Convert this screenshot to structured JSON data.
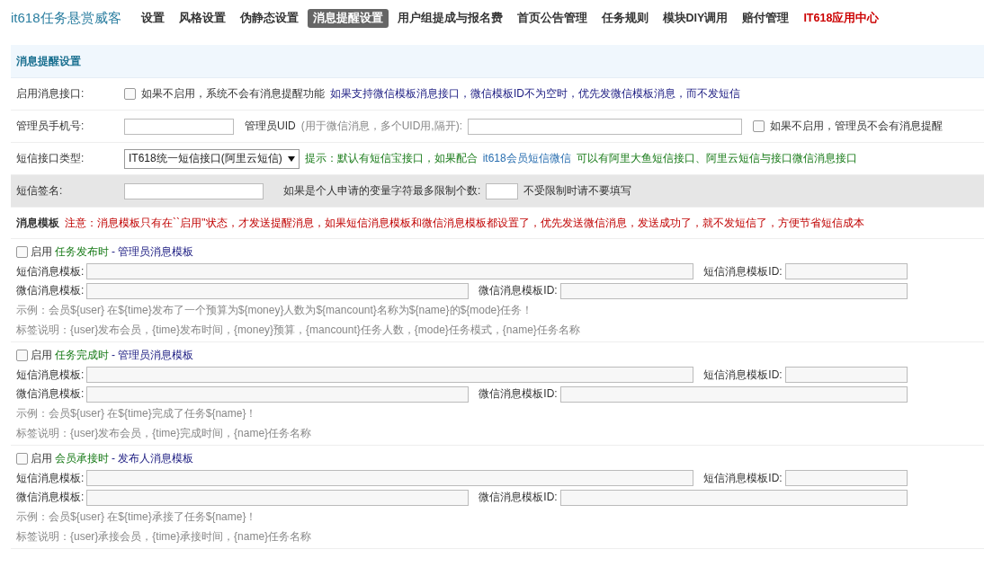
{
  "brand": "it618任务悬赏威客",
  "nav": [
    {
      "label": "设置",
      "selected": false,
      "kind": "normal"
    },
    {
      "label": "风格设置",
      "selected": false,
      "kind": "normal"
    },
    {
      "label": "伪静态设置",
      "selected": false,
      "kind": "normal"
    },
    {
      "label": "消息提醒设置",
      "selected": true,
      "kind": "normal"
    },
    {
      "label": "用户组提成与报名费",
      "selected": false,
      "kind": "normal"
    },
    {
      "label": "首页公告管理",
      "selected": false,
      "kind": "normal"
    },
    {
      "label": "任务规则",
      "selected": false,
      "kind": "normal"
    },
    {
      "label": "模块DIY调用",
      "selected": false,
      "kind": "normal"
    },
    {
      "label": "赔付管理",
      "selected": false,
      "kind": "normal"
    },
    {
      "label": "IT618应用中心",
      "selected": false,
      "kind": "highlight"
    }
  ],
  "section_title": "消息提醒设置",
  "enable_row": {
    "label": "启用消息接口:",
    "checked": false,
    "hint": "如果不启用，系统不会有消息提醒功能",
    "note": "如果支持微信模板消息接口，微信模板ID不为空时，优先发微信模板消息，而不发短信"
  },
  "admin_row": {
    "label": "管理员手机号:",
    "uid_label": "管理员UID",
    "uid_hint": "(用于微信消息，多个UID用,隔开):",
    "checked": false,
    "hint": "如果不启用，管理员不会有消息提醒"
  },
  "sms_type_row": {
    "label": "短信接口类型:",
    "value": "IT618统一短信接口(阿里云短信)",
    "tip": "提示：默认有短信宝接口，如果配合",
    "link": "it618会员短信微信",
    "tip_end": "可以有阿里大鱼短信接口、阿里云短信与接口微信消息接口"
  },
  "signature_row": {
    "label": "短信签名:",
    "limit_label": "如果是个人申请的变量字符最多限制个数:",
    "limit_hint": "不受限制时请不要填写"
  },
  "notice": {
    "title": "消息模板",
    "text": "注意：消息模板只有在``启用''状态，才发送提醒消息，如果短信消息模板和微信消息模板都设置了，优先发送微信消息，发送成功了，就不发短信了，方便节省短信成本"
  },
  "templates": [
    {
      "enabled": false,
      "enable_label": "启用",
      "event": "任务发布时",
      "audience": "- 管理员消息模板",
      "sms_label": "短信消息模板:",
      "sms_id_label": "短信消息模板ID:",
      "wx_label": "微信消息模板:",
      "wx_id_label": "微信消息模板ID:",
      "example": "示例：会员${user} 在${time}发布了一个预算为${money}人数为${mancount}名称为${name}的${mode}任务！",
      "tags": "标签说明：{user}发布会员，{time}发布时间，{money}预算，{mancount}任务人数，{mode}任务模式，{name}任务名称"
    },
    {
      "enabled": false,
      "enable_label": "启用",
      "event": "任务完成时",
      "audience": "- 管理员消息模板",
      "sms_label": "短信消息模板:",
      "sms_id_label": "短信消息模板ID:",
      "wx_label": "微信消息模板:",
      "wx_id_label": "微信消息模板ID:",
      "example": "示例：会员${user} 在${time}完成了任务${name}！",
      "tags": "标签说明：{user}发布会员，{time}完成时间，{name}任务名称"
    },
    {
      "enabled": false,
      "enable_label": "启用",
      "event": "会员承接时",
      "audience": "- 发布人消息模板",
      "sms_label": "短信消息模板:",
      "sms_id_label": "短信消息模板ID:",
      "wx_label": "微信消息模板:",
      "wx_id_label": "微信消息模板ID:",
      "example": "示例：会员${user} 在${time}承接了任务${name}！",
      "tags": "标签说明：{user}承接会员，{time}承接时间，{name}任务名称"
    }
  ]
}
